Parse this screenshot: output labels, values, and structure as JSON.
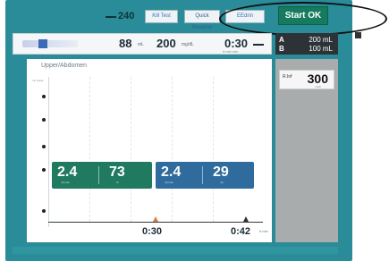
{
  "toolbar": {
    "volume_value": "240",
    "btn1_label": "Kill Test",
    "btn2_label": "Quick Reverse",
    "btn3_label": "EEdrin",
    "start_ok_label": "Start OK"
  },
  "status": {
    "value1": "88",
    "value1_unit": "mL",
    "value2": "200",
    "value2_unit": "mg/dL",
    "time": "0:30",
    "time_sub": "h:min  min"
  },
  "ab_panel": {
    "row_a_label": "A",
    "row_a_value": "200 mL",
    "row_b_label": "B",
    "row_b_value": "100 mL"
  },
  "graph": {
    "title": "Upper/Abdomen",
    "y_label": "mL Anest",
    "block_green": {
      "value1": "2.4",
      "value1_unit": "mL/min",
      "value2": "73",
      "value2_unit": "%"
    },
    "block_blue": {
      "value1": "2.4",
      "value1_unit": "mL/min",
      "value2": "29",
      "value2_unit": "mL"
    },
    "x_label_1": "0:30",
    "x_label_2": "0:42",
    "x_unit": "h:min"
  },
  "rate": {
    "label": "R.Inf",
    "value": "300",
    "unit": "mL/h"
  },
  "colors": {
    "device_teal": "#2a8c98",
    "start_ok_green": "#157a5e",
    "block_green": "#1f7a60",
    "block_blue": "#2f6b9c",
    "marker_orange": "#e07a3a"
  }
}
